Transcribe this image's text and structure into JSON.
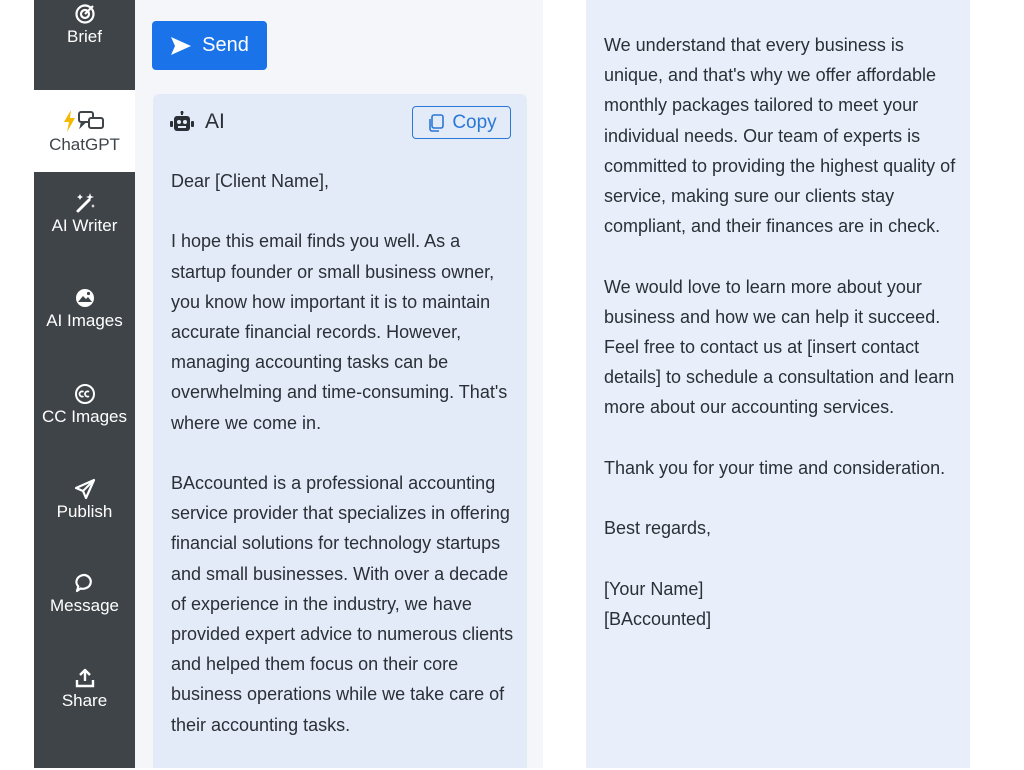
{
  "sidebar": {
    "items": [
      {
        "label": "Brief",
        "icon": "target-icon"
      },
      {
        "label": "ChatGPT",
        "icon": "chatgpt-icon",
        "active": true
      },
      {
        "label": "AI Writer",
        "icon": "magic-wand-icon"
      },
      {
        "label": "AI Images",
        "icon": "image-icon"
      },
      {
        "label": "CC Images",
        "icon": "cc-icon"
      },
      {
        "label": "Publish",
        "icon": "send-icon"
      },
      {
        "label": "Message",
        "icon": "message-icon"
      },
      {
        "label": "Share",
        "icon": "share-icon"
      }
    ]
  },
  "toolbar": {
    "send_label": "Send"
  },
  "ai_card": {
    "title": "AI",
    "copy_label": "Copy",
    "paragraphs": [
      "Dear [Client Name],",
      "I hope this email finds you well. As a startup founder or small business owner, you know how important it is to maintain accurate financial records. However, managing accounting tasks can be overwhelming and time-consuming. That's where we come in.",
      "BAccounted is a professional accounting service provider that specializes in offering financial solutions for technology startups and small businesses. With over a decade of experience in the industry, we have provided expert advice to numerous clients and helped them focus on their core business operations while we take care of their accounting tasks."
    ]
  },
  "right_panel": {
    "paragraphs": [
      "We understand that every business is unique, and that's why we offer affordable monthly packages tailored to meet your individual needs. Our team of experts is committed to providing the highest quality of service, making sure our clients stay compliant, and their finances are in check.",
      "We would love to learn more about your business and how we can help it succeed. Feel free to contact us at [insert contact details] to schedule a consultation and learn more about our accounting services.",
      "Thank you for your time and consideration.",
      "Best regards,"
    ],
    "signature": [
      "[Your Name]",
      "[BAccounted]"
    ]
  },
  "colors": {
    "sidebar_bg": "#3f4448",
    "accent": "#1a73e8",
    "ai_card_bg": "#e3ebf9",
    "right_card_bg": "#e9effa"
  }
}
